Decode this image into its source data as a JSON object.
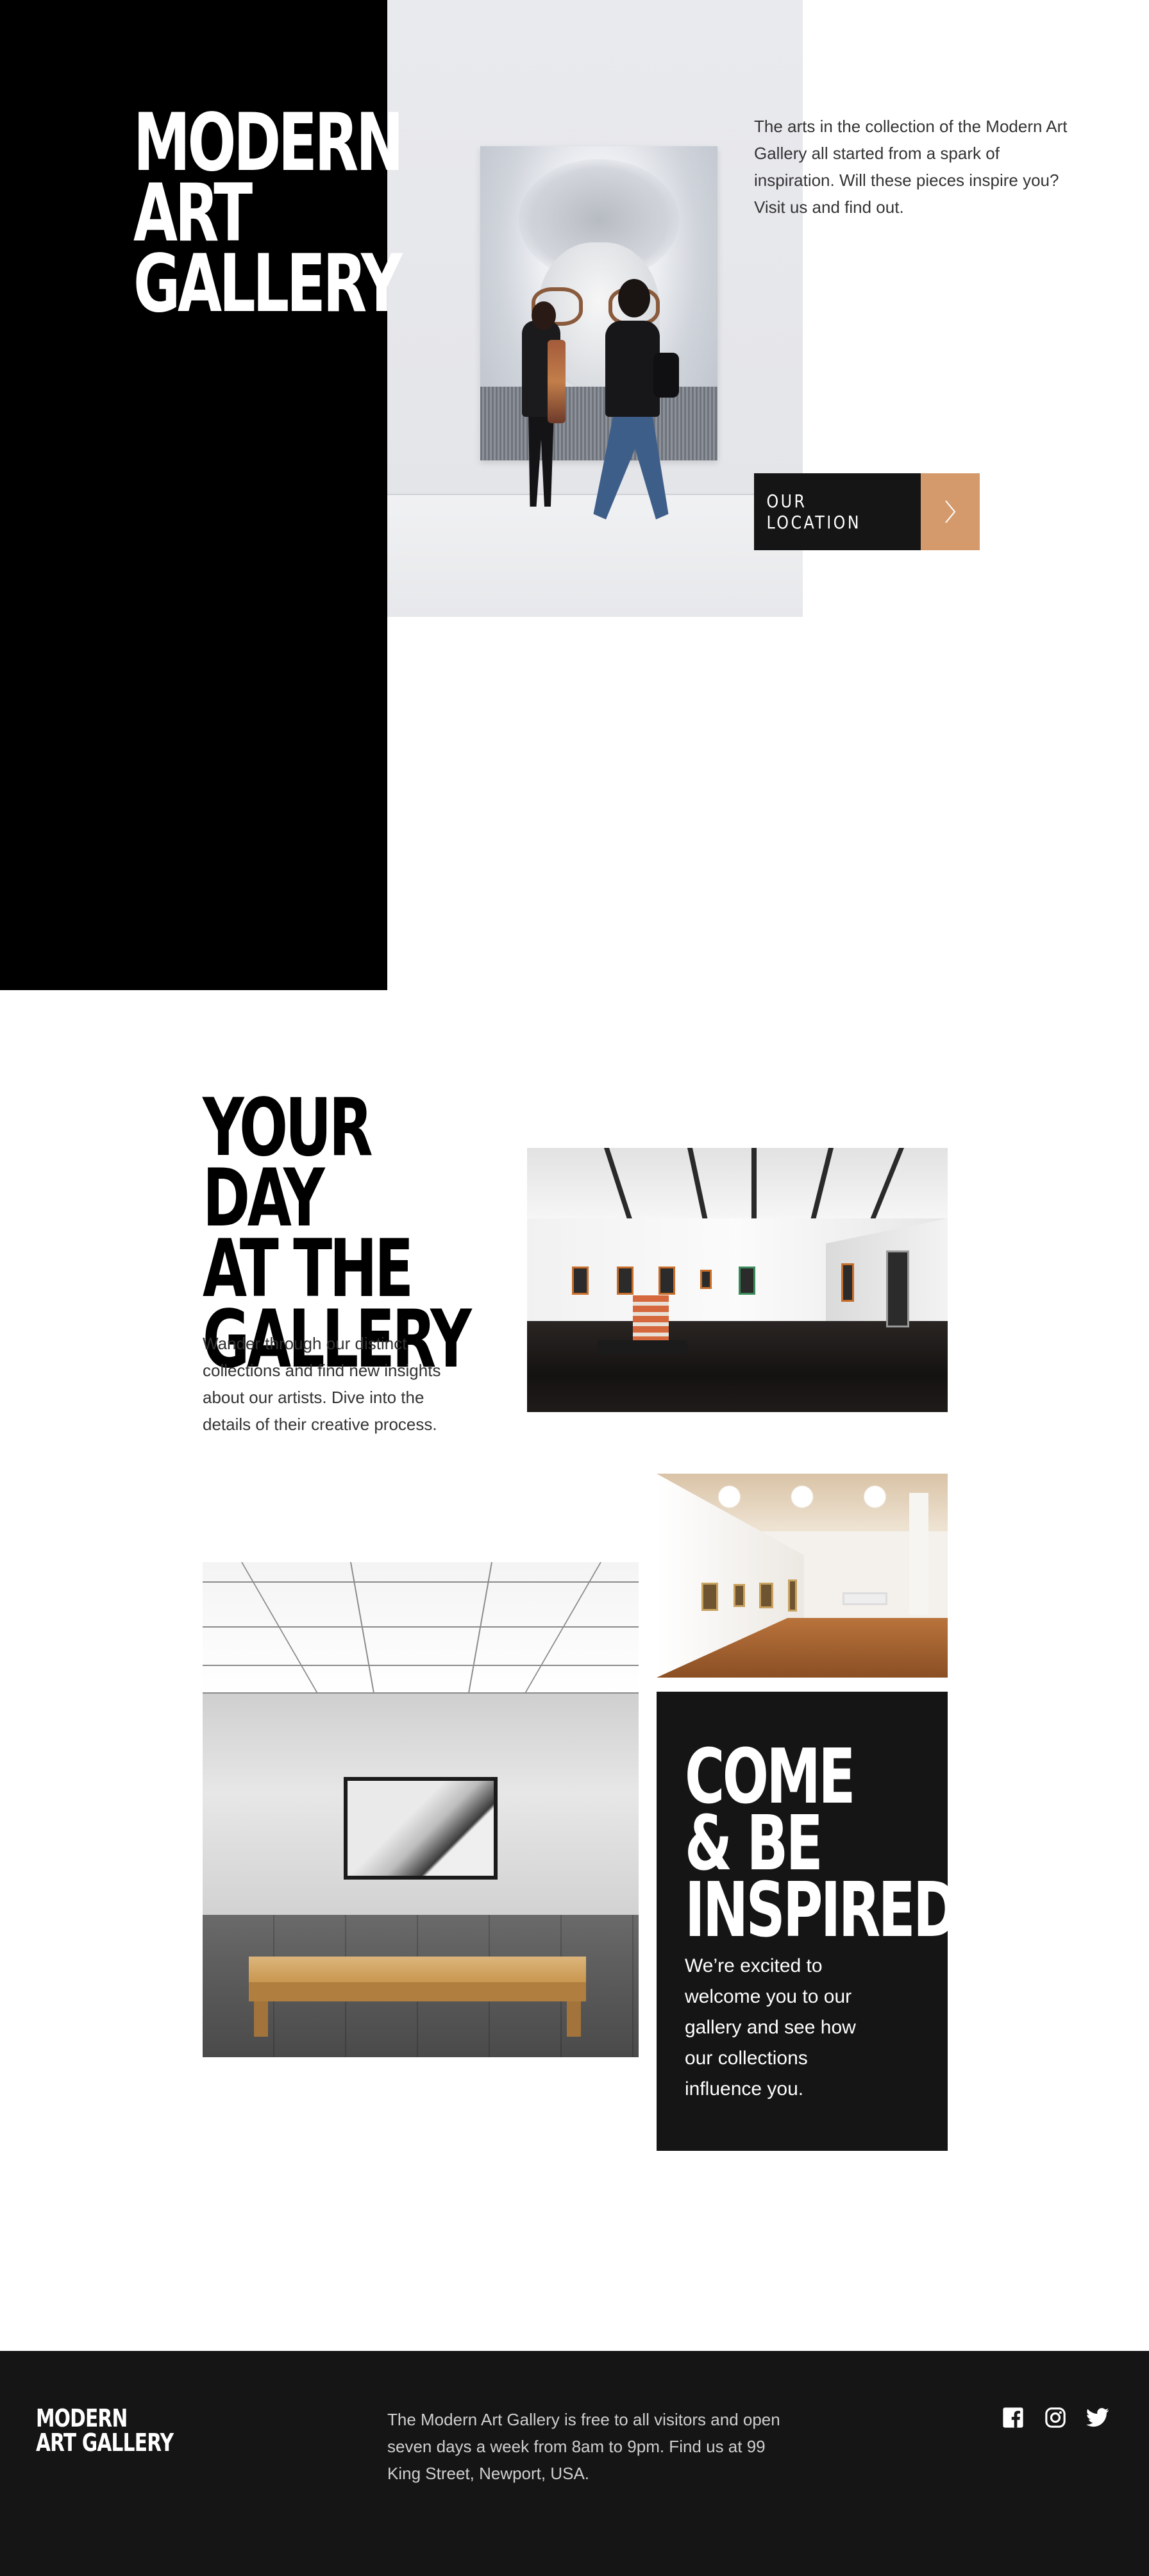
{
  "hero": {
    "title_line1": "MODERN",
    "title_line2": "ART GALLERY",
    "description": "The arts in the collection of the Modern Art Gallery all started from a spark of inspiration. Will these pieces inspire you? Visit us and find out.",
    "location_button": "OUR LOCATION",
    "arrow_icon": "chevron-right-icon"
  },
  "day": {
    "title_line1": "YOUR DAY",
    "title_line2": "AT THE",
    "title_line3": "GALLERY",
    "description": "Wander through our distinct collections and find new insights about our artists. Dive into the details of their creative process."
  },
  "inspired": {
    "title_line1": "COME",
    "title_line2": "& BE",
    "title_line3": "INSPIRED",
    "description": "We’re excited to welcome you to our gallery and see how our collections influence you."
  },
  "footer": {
    "logo_line1": "MODERN",
    "logo_line2": "ART GALLERY",
    "text": "The Modern Art Gallery is free to all visitors and open seven days a week from 8am to 9pm. Find us at 99 King Street, Newport, USA.",
    "social": [
      "facebook-icon",
      "instagram-icon",
      "twitter-icon"
    ]
  },
  "colors": {
    "black": "#000000",
    "dark": "#151515",
    "accent": "#d59a6b",
    "text_grey": "#333333"
  }
}
